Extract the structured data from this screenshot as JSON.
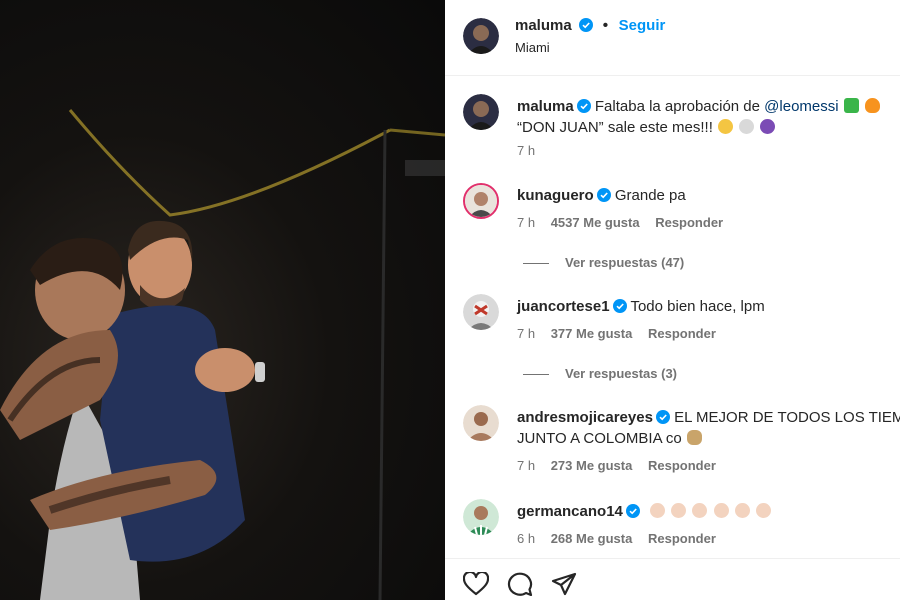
{
  "header": {
    "username": "maluma",
    "follow_label": "Seguir",
    "location": "Miami"
  },
  "caption": {
    "username": "maluma",
    "text_before": "Faltaba la aprobación de ",
    "mention": "@leomessi",
    "line2": "“DON JUAN” sale este mes!!!",
    "time": "7 h"
  },
  "comments": [
    {
      "username": "kunaguero",
      "text": "Grande pa",
      "time": "7 h",
      "likes": "4537 Me gusta",
      "reply_label": "Responder",
      "view_replies": "Ver respuestas (47)"
    },
    {
      "username": "juancortese1",
      "text": "Todo bien hace, lpm",
      "time": "7 h",
      "likes": "377 Me gusta",
      "reply_label": "Responder",
      "view_replies": "Ver respuestas (3)"
    },
    {
      "username": "andresmojicareyes",
      "text": "EL MEJOR DE TODOS LOS TIEMPOS",
      "text_line2": "JUNTO A COLOMBIA co",
      "time": "7 h",
      "likes": "273 Me gusta",
      "reply_label": "Responder"
    },
    {
      "username": "germancano14",
      "text": "",
      "time": "6 h",
      "likes": "268 Me gusta",
      "reply_label": "Responder"
    }
  ],
  "icons": {
    "like": "heart-icon",
    "comment": "comment-icon",
    "share": "share-icon",
    "verified": "verified-badge-icon"
  },
  "colors": {
    "accent": "#0095f6",
    "mention": "#00376b",
    "verified": "#0095f6",
    "muted": "#737373"
  }
}
